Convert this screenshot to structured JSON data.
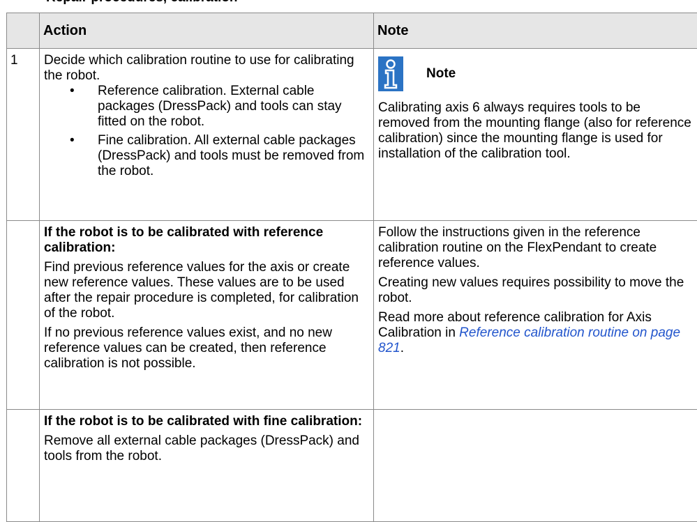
{
  "heading_clipped": "Repair procedures, calibration",
  "table": {
    "headers": {
      "num": "",
      "action": "Action",
      "note": "Note"
    },
    "rows": [
      {
        "num": "1",
        "action_intro": "Decide which calibration routine to use for calibrating the robot.",
        "bullets": [
          "Reference calibration. External cable packages (DressPack) and tools can stay fitted on the robot.",
          "Fine calibration. All external cable packages (DressPack) and tools must be removed from the robot."
        ],
        "bullet_symbol": "•",
        "note_title": "Note",
        "note_icon": "info-icon",
        "note_text": "Calibrating axis 6 always requires tools to be removed from the mounting flange (also for reference calibration) since the mounting flange is used for installation of the calibration tool."
      },
      {
        "num": "",
        "action_heading": "If the robot is to be calibrated with reference calibration:",
        "action_p1": "Find previous reference values for the axis or create new reference values. These values are to be used after the repair procedure is completed, for calibration of the robot.",
        "action_p2": "If no previous reference values exist, and no new reference values can be created, then reference calibration is not possible.",
        "note_p1": "Follow the instructions given in the reference calibration routine on the FlexPendant to create reference values.",
        "note_p2": "Creating new values requires possibility to move the robot.",
        "note_p3_prefix": "Read more about reference calibration for Axis Calibration in ",
        "note_p3_link": "Reference calibration routine on page 821",
        "note_p3_suffix": "."
      },
      {
        "num": "",
        "action_heading": "If the robot is to be calibrated with fine calibration:",
        "action_p1": "Remove all external cable packages (DressPack) and tools from the robot.",
        "note": ""
      }
    ]
  },
  "colors": {
    "header_bg": "#e6e6e6",
    "border": "#8a8a8a",
    "icon_blue": "#2b73c4",
    "link": "#2255cc"
  }
}
